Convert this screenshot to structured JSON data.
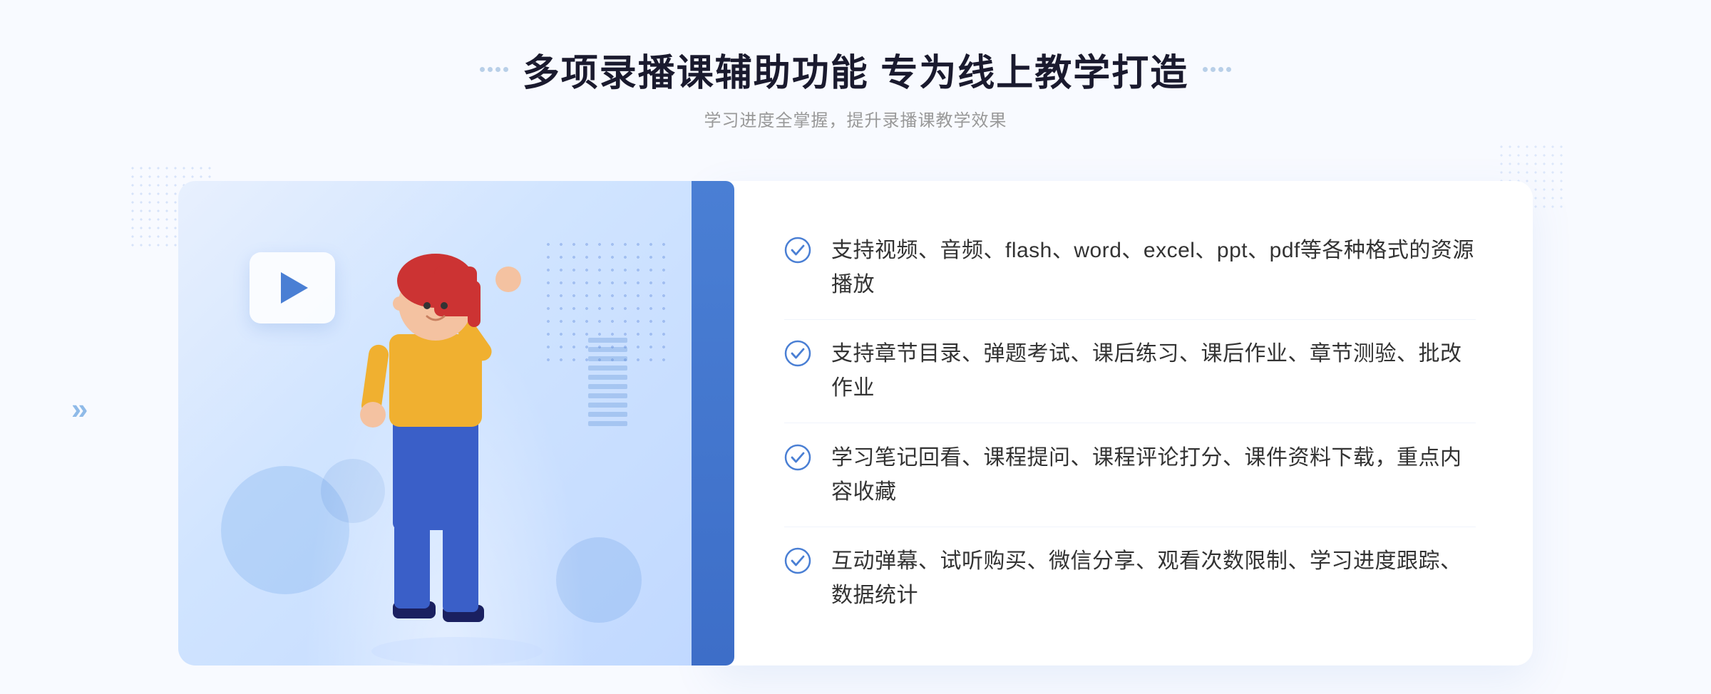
{
  "page": {
    "background": "#f8faff"
  },
  "header": {
    "title": "多项录播课辅助功能 专为线上教学打造",
    "subtitle": "学习进度全掌握，提升录播课教学效果"
  },
  "features": [
    {
      "id": "feature-1",
      "text": "支持视频、音频、flash、word、excel、ppt、pdf等各种格式的资源播放"
    },
    {
      "id": "feature-2",
      "text": "支持章节目录、弹题考试、课后练习、课后作业、章节测验、批改作业"
    },
    {
      "id": "feature-3",
      "text": "学习笔记回看、课程提问、课程评论打分、课件资料下载，重点内容收藏"
    },
    {
      "id": "feature-4",
      "text": "互动弹幕、试听购买、微信分享、观看次数限制、学习进度跟踪、数据统计"
    }
  ],
  "icons": {
    "check": "check-circle-icon",
    "chevron": "chevron-right-icon",
    "play": "play-icon"
  },
  "colors": {
    "primary": "#4a7fd4",
    "primary_dark": "#3d6ec8",
    "title": "#1a1a2e",
    "text": "#333333",
    "subtitle": "#999999",
    "check_color": "#4a7fd4",
    "bg_light": "#f8faff"
  }
}
